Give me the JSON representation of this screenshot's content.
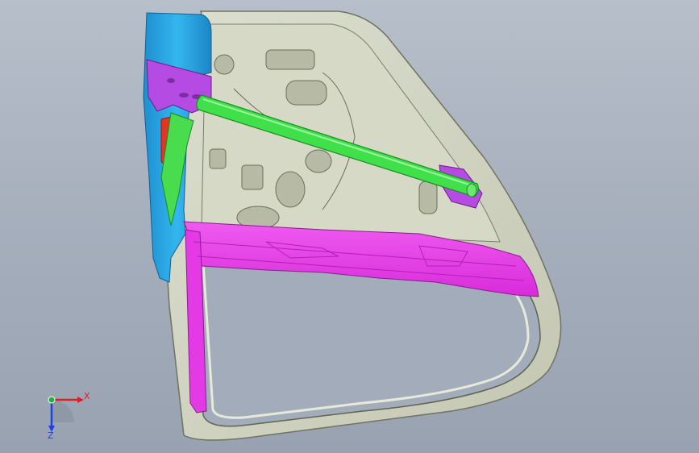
{
  "viewport": {
    "background": "#a7b0bd"
  },
  "model": {
    "parts": [
      {
        "name": "door-inner-panel",
        "color": "#cfd3bf"
      },
      {
        "name": "hinge-pillar-reinforcement",
        "color": "#26a9e0"
      },
      {
        "name": "waist-reinforcement-beam",
        "color": "#e335e6"
      },
      {
        "name": "intrusion-beam",
        "color": "#3fe04a"
      },
      {
        "name": "mounting-bracket",
        "color": "#b64be3"
      },
      {
        "name": "hinge-patch",
        "color": "#e53422"
      }
    ]
  },
  "triad": {
    "x_label": "X",
    "z_label": "Z",
    "x_color": "#e02020",
    "y_color": "#20b040",
    "z_color": "#2040e0"
  }
}
